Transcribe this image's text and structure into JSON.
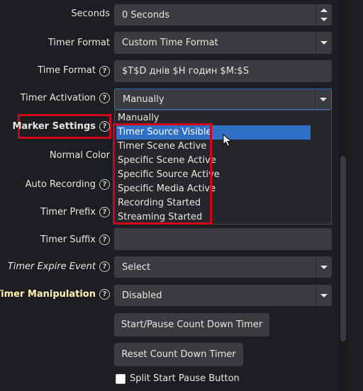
{
  "rows": {
    "seconds": {
      "label": "Seconds",
      "value": "0 Seconds"
    },
    "timer_format": {
      "label": "Timer Format",
      "value": "Custom Time Format"
    },
    "time_format": {
      "label": "Time Format",
      "value": "$T$D днів $H годин $M:$S"
    },
    "timer_activation": {
      "label": "Timer Activation",
      "value": "Manually"
    },
    "marker_settings": {
      "label": "Marker Settings"
    },
    "normal_color": {
      "label": "Normal Color"
    },
    "auto_recording": {
      "label": "Auto Recording"
    },
    "timer_prefix": {
      "label": "Timer Prefix"
    },
    "timer_suffix": {
      "label": "Timer Suffix",
      "value": ""
    },
    "timer_expire_event": {
      "label": "Timer Expire Event",
      "value": "Select"
    },
    "timer_manipulation": {
      "label": "Timer Manipulation",
      "value": "Disabled"
    }
  },
  "dropdown": {
    "options": [
      "Manually",
      "Timer Source Visible",
      "Timer Scene Active",
      "Specific Scene Active",
      "Specific Source Active",
      "Specific Media Active",
      "Recording Started",
      "Streaming Started"
    ],
    "highlighted": "Timer Source Visible"
  },
  "buttons": {
    "start_pause": "Start/Pause Count Down Timer",
    "reset": "Reset Count Down Timer"
  },
  "checkbox": {
    "label": "Split Start Pause Button",
    "checked": false
  },
  "help_glyph": "?",
  "colors": {
    "background": "#1e1e22",
    "field": "#3b3b40",
    "highlight": "#2f6fc5",
    "annotation_red": "#d2001c",
    "heading_yellow": "#fff2b3"
  }
}
